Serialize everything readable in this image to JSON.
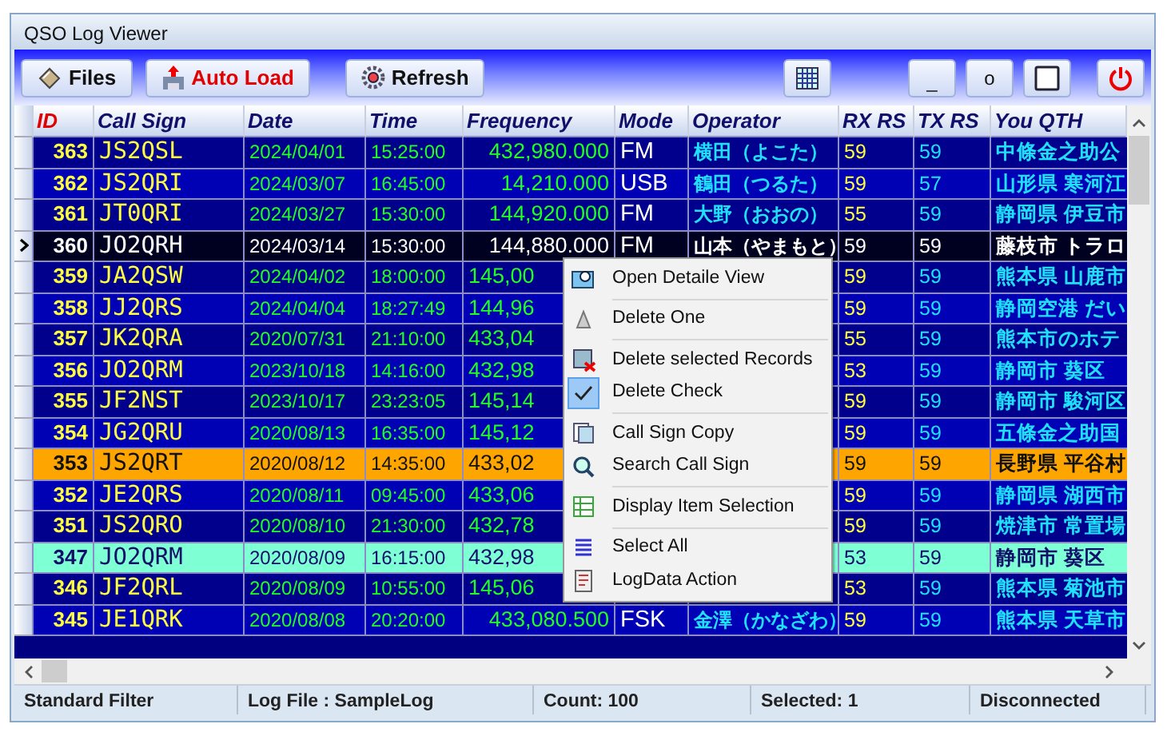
{
  "window": {
    "title": "QSO Log Viewer"
  },
  "toolbar": {
    "buttons": [
      {
        "kind": "files",
        "label": "Files"
      },
      {
        "kind": "autoload",
        "label": "Auto Load"
      },
      {
        "kind": "refresh",
        "label": "Refresh"
      }
    ],
    "right_buttons": [
      {
        "kind": "grid"
      },
      {
        "kind": "text",
        "label": "_"
      },
      {
        "kind": "text",
        "label": "o"
      },
      {
        "kind": "square"
      },
      {
        "kind": "power"
      }
    ]
  },
  "table": {
    "columns": [
      "ID",
      "Call Sign",
      "Date",
      "Time",
      "Frequency",
      "Mode",
      "Operator",
      "RX RS",
      "TX RS",
      "You QTH"
    ],
    "rows": [
      {
        "id": "363",
        "call_sign": "JS2QSL",
        "date": "2024/04/01",
        "time": "15:25:00",
        "frequency": "432,980.000",
        "mode": "FM",
        "operator": "横田（よこた）",
        "rx_rs": "59",
        "tx_rs": "59",
        "qth": "中條金之助公",
        "kind": "normal",
        "selected": false
      },
      {
        "id": "362",
        "call_sign": "JS2QRI",
        "date": "2024/03/07",
        "time": "16:45:00",
        "frequency": "14,210.000",
        "mode": "USB",
        "operator": "鶴田（つるた）",
        "rx_rs": "59",
        "tx_rs": "57",
        "qth": "山形県 寒河江",
        "kind": "normal",
        "selected": false
      },
      {
        "id": "361",
        "call_sign": "JT0QRI",
        "date": "2024/03/27",
        "time": "15:30:00",
        "frequency": "144,920.000",
        "mode": "FM",
        "operator": "大野（おおの）",
        "rx_rs": "55",
        "tx_rs": "59",
        "qth": "静岡県 伊豆市",
        "kind": "normal",
        "selected": false
      },
      {
        "id": "360",
        "call_sign": "JO2QRH",
        "date": "2024/03/14",
        "time": "15:30:00",
        "frequency": "144,880.000",
        "mode": "FM",
        "operator": "山本（やまもと）",
        "rx_rs": "59",
        "tx_rs": "59",
        "qth": "藤枝市 トラロ",
        "kind": "normal",
        "selected": true
      },
      {
        "id": "359",
        "call_sign": "JA2QSW",
        "date": "2024/04/02",
        "time": "18:00:00",
        "frequency": "145,00",
        "rx_rs": "59",
        "tx_rs": "59",
        "qth": "熊本県 山鹿市",
        "kind": "normal",
        "selected": false
      },
      {
        "id": "358",
        "call_sign": "JJ2QRS",
        "date": "2024/04/04",
        "time": "18:27:49",
        "frequency": "144,96",
        "rx_rs": "59",
        "tx_rs": "59",
        "qth": "静岡空港 だい",
        "kind": "normal",
        "selected": false
      },
      {
        "id": "357",
        "call_sign": "JK2QRA",
        "date": "2020/07/31",
        "time": "21:10:00",
        "frequency": "433,04",
        "rx_rs": "55",
        "tx_rs": "59",
        "qth": "熊本市のホテ",
        "kind": "normal",
        "selected": false
      },
      {
        "id": "356",
        "call_sign": "JO2QRM",
        "date": "2023/10/18",
        "time": "14:16:00",
        "frequency": "432,98",
        "rx_rs": "53",
        "tx_rs": "59",
        "qth": "静岡市 葵区",
        "kind": "normal",
        "selected": false
      },
      {
        "id": "355",
        "call_sign": "JF2NST",
        "date": "2023/10/17",
        "time": "23:23:05",
        "frequency": "145,14",
        "rx_rs": "59",
        "tx_rs": "59",
        "qth": "静岡市 駿河区",
        "kind": "normal",
        "selected": false
      },
      {
        "id": "354",
        "call_sign": "JG2QRU",
        "date": "2020/08/13",
        "time": "16:35:00",
        "frequency": "145,12",
        "rx_rs": "59",
        "tx_rs": "59",
        "qth": "五條金之助国",
        "kind": "normal",
        "selected": false
      },
      {
        "id": "353",
        "call_sign": "JS2QRT",
        "date": "2020/08/12",
        "time": "14:35:00",
        "frequency": "433,02",
        "rx_rs": "59",
        "tx_rs": "59",
        "qth": "長野県 平谷村",
        "kind": "orange",
        "selected": false
      },
      {
        "id": "352",
        "call_sign": "JE2QRS",
        "date": "2020/08/11",
        "time": "09:45:00",
        "frequency": "433,06",
        "rx_rs": "59",
        "tx_rs": "59",
        "qth": "静岡県 湖西市",
        "kind": "normal",
        "selected": false
      },
      {
        "id": "351",
        "call_sign": "JS2QRO",
        "date": "2020/08/10",
        "time": "21:30:00",
        "frequency": "432,78",
        "rx_rs": "59",
        "tx_rs": "59",
        "qth": "焼津市 常置場",
        "kind": "normal",
        "selected": false
      },
      {
        "id": "347",
        "call_sign": "JO2QRM",
        "date": "2020/08/09",
        "time": "16:15:00",
        "frequency": "432,98",
        "rx_rs": "53",
        "tx_rs": "59",
        "qth": "静岡市 葵区",
        "kind": "aqua",
        "selected": false
      },
      {
        "id": "346",
        "call_sign": "JF2QRL",
        "date": "2020/08/09",
        "time": "10:55:00",
        "frequency": "145,06",
        "rx_rs": "53",
        "tx_rs": "59",
        "qth": "熊本県 菊池市",
        "kind": "normal",
        "selected": false
      },
      {
        "id": "345",
        "call_sign": "JE1QRK",
        "date": "2020/08/08",
        "time": "20:20:00",
        "frequency": "433,080.500",
        "mode": "FSK",
        "operator": "金澤（かなざわ）",
        "rx_rs": "59",
        "tx_rs": "59",
        "qth": "熊本県 天草市",
        "kind": "normal",
        "selected": false
      }
    ]
  },
  "context_menu": {
    "groups": [
      [
        {
          "label": "Open Detaile View",
          "checked": false
        }
      ],
      [
        {
          "label": "Delete One",
          "checked": false
        }
      ],
      [
        {
          "label": "Delete selected Records",
          "checked": false
        },
        {
          "label": "Delete Check",
          "checked": true
        }
      ],
      [
        {
          "label": "Call Sign Copy",
          "checked": false
        },
        {
          "label": "Search Call Sign",
          "checked": false
        }
      ],
      [
        {
          "label": "Display Item Selection",
          "checked": false
        }
      ],
      [
        {
          "label": "Select All",
          "checked": false
        },
        {
          "label": "LogData Action",
          "checked": false
        }
      ]
    ]
  },
  "status_bar": [
    "Standard Filter",
    "Log File : SampleLog",
    "Count: 100",
    "Selected: 1",
    "Disconnected"
  ]
}
